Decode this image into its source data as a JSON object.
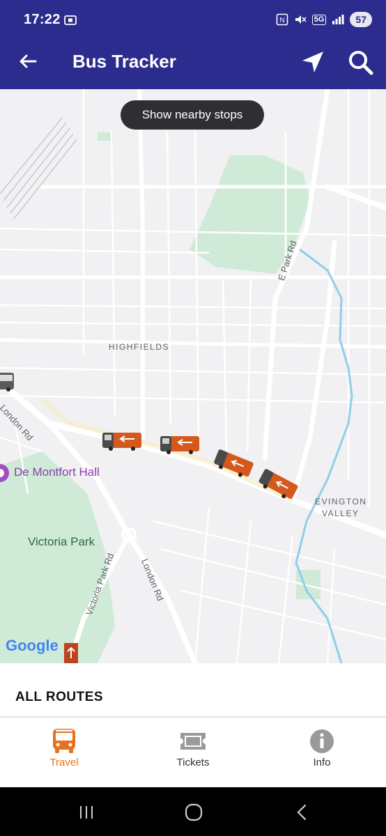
{
  "status_bar": {
    "time": "17:22",
    "battery": "57",
    "network": "5G"
  },
  "app_bar": {
    "title": "Bus Tracker"
  },
  "map": {
    "nearby_button": "Show nearby stops",
    "labels": {
      "highfields": "HIGHFIELDS",
      "london_rd_top": "London Rd",
      "e_park_rd": "E Park Rd",
      "de_montfort_hall": "De Montfort Hall",
      "victoria_park": "Victoria Park",
      "victoria_park_rd": "Victoria Park Rd",
      "london_rd_bottom": "London Rd",
      "evington_valley_1": "EVINGTON",
      "evington_valley_2": "VALLEY"
    },
    "attribution": "Google",
    "colors": {
      "park": "#cfead6",
      "water": "#8ecfe8",
      "road": "#ffffff",
      "bus_body": "#d5581d"
    }
  },
  "sheet": {
    "header": "ALL ROUTES"
  },
  "bottom_nav": {
    "items": [
      {
        "label": "Travel",
        "icon": "bus-icon",
        "active": true,
        "color": "#e8711d"
      },
      {
        "label": "Tickets",
        "icon": "ticket-icon",
        "active": false,
        "color": "#9a9a9a"
      },
      {
        "label": "Info",
        "icon": "info-icon",
        "active": false,
        "color": "#9a9a9a"
      }
    ]
  }
}
